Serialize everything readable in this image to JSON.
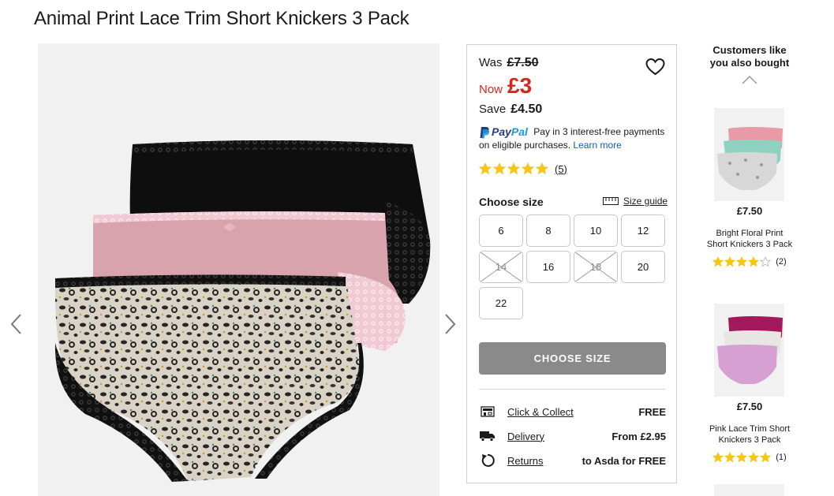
{
  "product": {
    "title": "Animal Print Lace Trim Short Knickers 3 Pack"
  },
  "price": {
    "was_label": "Was",
    "was_value": "£7.50",
    "now_label": "Now",
    "now_value": "£3",
    "save_label": "Save",
    "save_value": "£4.50"
  },
  "paypal": {
    "logo_pay": "Pay",
    "logo_pal": "Pal",
    "text": "Pay in 3 interest-free payments on eligible purchases.",
    "link": "Learn more"
  },
  "rating": {
    "stars": 5,
    "count": "(5)"
  },
  "size": {
    "heading": "Choose size",
    "guide_label": "Size guide",
    "options": [
      {
        "label": "6",
        "available": true
      },
      {
        "label": "8",
        "available": true
      },
      {
        "label": "10",
        "available": true
      },
      {
        "label": "12",
        "available": true
      },
      {
        "label": "14",
        "available": false
      },
      {
        "label": "16",
        "available": true
      },
      {
        "label": "18",
        "available": false
      },
      {
        "label": "20",
        "available": true
      },
      {
        "label": "22",
        "available": true
      }
    ]
  },
  "cta": {
    "label": "CHOOSE SIZE"
  },
  "delivery": [
    {
      "icon": "store-icon",
      "label": "Click & Collect",
      "value": "FREE"
    },
    {
      "icon": "truck-icon",
      "label": "Delivery",
      "value": "From £2.95"
    },
    {
      "icon": "returns-icon",
      "label": "Returns",
      "value": "to Asda for FREE"
    }
  ],
  "recommendations": {
    "title_line1": "Customers like",
    "title_line2": "you also bought",
    "items": [
      {
        "price": "£7.50",
        "name_line1": "Bright Floral Print",
        "name_line2": "Short Knickers 3 Pack",
        "rating": 4,
        "count": "(2)"
      },
      {
        "price": "£7.50",
        "name_line1": "Pink Lace Trim Short",
        "name_line2": "Knickers 3 Pack",
        "rating": 5,
        "count": "(1)"
      }
    ]
  },
  "colors": {
    "accent_red": "#d7261e",
    "star_gold": "#f5c518",
    "cta_grey": "#8a8a8a",
    "link_blue": "#0f5fb5"
  }
}
